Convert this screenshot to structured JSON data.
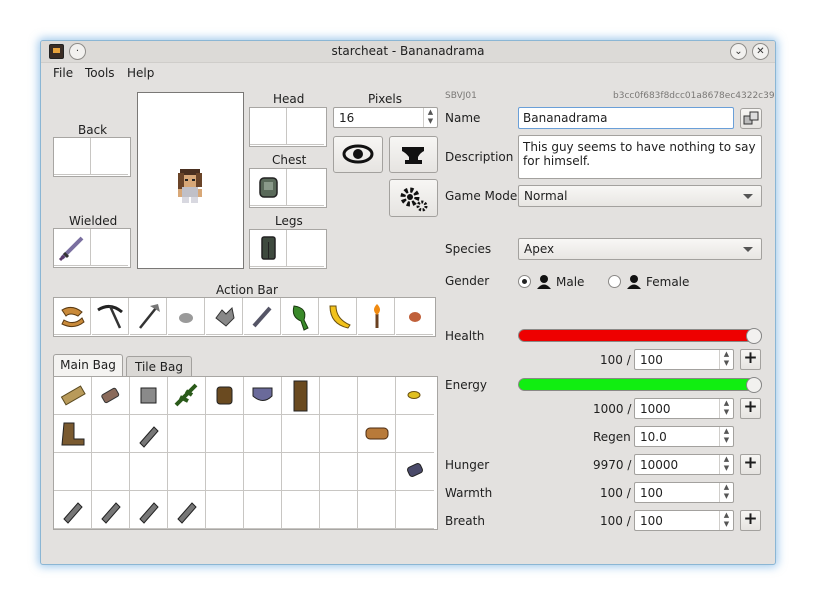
{
  "window": {
    "title": "starcheat - Bananadrama"
  },
  "menu": [
    "File",
    "Tools",
    "Help"
  ],
  "equipment": {
    "head": "Head",
    "chest": "Chest",
    "legs": "Legs",
    "back": "Back",
    "wielded": "Wielded",
    "pixels_label": "Pixels",
    "pixels_value": "16"
  },
  "action_bar_label": "Action Bar",
  "tabs": [
    "Main Bag",
    "Tile Bag"
  ],
  "player": {
    "save_id": "SBVJ01",
    "uuid": "b3cc0f683f8dcc01a8678ec4322c392a",
    "name_label": "Name",
    "name": "Bananadrama",
    "description_label": "Description",
    "description": "This guy seems to have nothing to say for himself.",
    "game_mode_label": "Game Mode",
    "game_mode": "Normal",
    "species_label": "Species",
    "species": "Apex",
    "gender_label": "Gender",
    "gender_male": "Male",
    "gender_female": "Female",
    "gender_selected": "Male"
  },
  "stats": {
    "health_label": "Health",
    "health_current": "100 /",
    "health_max": "100",
    "health_level": 1.0,
    "energy_label": "Energy",
    "energy_current": "1000 /",
    "energy_max": "1000",
    "energy_level": 1.0,
    "regen_label": "Regen",
    "regen_value": "10.0",
    "hunger_label": "Hunger",
    "hunger_current": "9970 /",
    "hunger_max": "10000",
    "warmth_label": "Warmth",
    "warmth_current": "100 /",
    "warmth_max": "100",
    "breath_label": "Breath",
    "breath_current": "100 /",
    "breath_max": "100"
  },
  "colors": {
    "health": "#ee0000",
    "energy": "#11ee11",
    "accent": "#6a9fd8"
  },
  "icons": [
    "view-icon",
    "anvil-icon",
    "settings-gears-icon",
    "randomize-dice-icon"
  ]
}
